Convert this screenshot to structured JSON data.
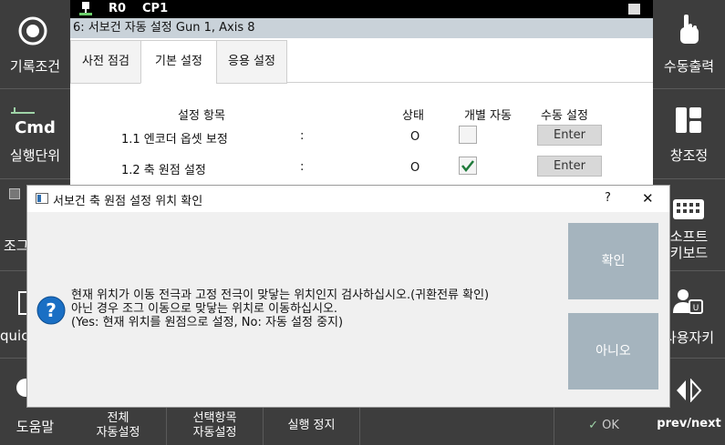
{
  "left_panel": {
    "record_condition": "기록조건",
    "cmd_label": "Cmd",
    "exec_unit": "실행단위",
    "jog_partial": "조그",
    "quick_partial": "quic",
    "help": "도움말"
  },
  "right_panel": {
    "manual_output": "수동출력",
    "window_arrange": "창조정",
    "soft_keyboard_1": "소프트",
    "soft_keyboard_2": "키보드",
    "user_key": "사용자키",
    "prev_next": "prev/next"
  },
  "status_bar": {
    "robot": "R0",
    "program": "CP1"
  },
  "window": {
    "title": "6: 서보건 자동 설정 Gun 1, Axis 8"
  },
  "tabs": [
    {
      "label": "사전 점검"
    },
    {
      "label": "기본 설정"
    },
    {
      "label": "응용 설정"
    }
  ],
  "table": {
    "headers": [
      "설정 항목",
      "상태",
      "개별 자동",
      "수동 설정"
    ],
    "rows": [
      {
        "item": "1.1 엔코더 옵셋 보정",
        "colon": ":",
        "status": "O",
        "checked": false,
        "button": "Enter"
      },
      {
        "item": "1.2 축 원점 설정",
        "colon": ":",
        "status": "O",
        "checked": true,
        "button": "Enter"
      }
    ]
  },
  "bottom_bar": {
    "auto_all_1": "전체",
    "auto_all_2": "자동설정",
    "auto_sel_1": "선택항목",
    "auto_sel_2": "자동설정",
    "stop": "실행 정지",
    "ok": "OK"
  },
  "dialog": {
    "title": "서보건 축 원점 설정 위치 확인",
    "help_mark": "?",
    "close_mark": "✕",
    "message_line1": "현재 위치가 이동 전극과 고정 전극이 맞닿는 위치인지 검사하십시오.(귀환전류 확인)",
    "message_line2": "아닌 경우 조그 이동으로 맞닿는 위치로 이동하십시오.",
    "message_line3": "(Yes: 현재 위치를 원점으로 설정, No: 자동 설정 중지)",
    "yes_label": "확인",
    "no_label": "아니오"
  }
}
